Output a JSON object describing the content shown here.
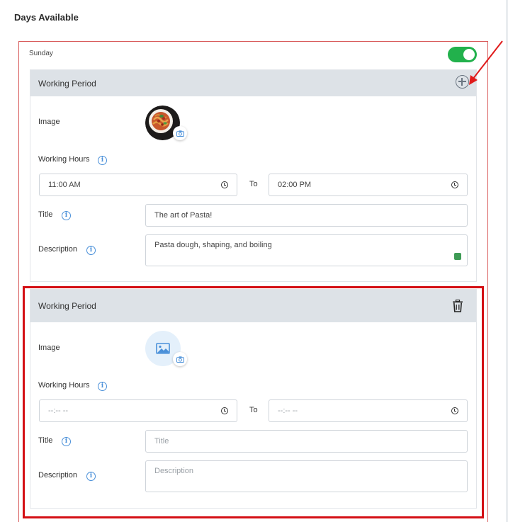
{
  "section_heading": "Days Available",
  "day": {
    "name": "Sunday",
    "enabled": true,
    "toggle_color": "#22b14c"
  },
  "labels": {
    "image": "Image",
    "working_hours": "Working Hours",
    "to": "To",
    "title": "Title",
    "description": "Description"
  },
  "periods": [
    {
      "heading": "Working Period",
      "action_icon": "add-circle-icon",
      "image": "pasta-dish-photo",
      "start_time": "11:00 AM",
      "end_time": "02:00 PM",
      "title_value": "The art of Pasta!",
      "description_value": "Pasta dough, shaping, and boiling"
    },
    {
      "heading": "Working Period",
      "action_icon": "trash-icon",
      "image": "image-placeholder-icon",
      "start_time_placeholder": "--:-- --",
      "end_time_placeholder": "--:-- --",
      "title_placeholder": "Title",
      "description_placeholder": "Description"
    }
  ],
  "annotation_color": "#d40f14"
}
